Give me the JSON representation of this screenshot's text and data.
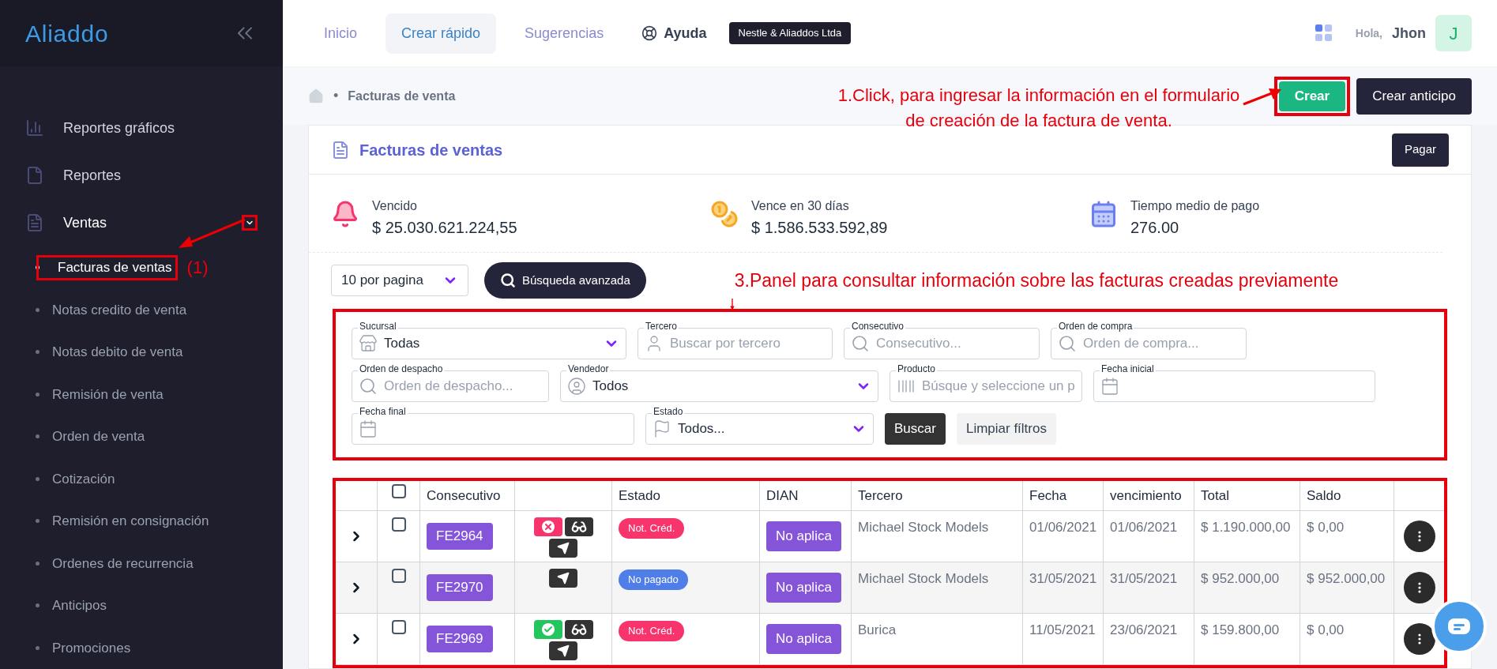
{
  "sidebar": {
    "logo": "Aliaddo",
    "items": [
      {
        "label": "Reportes gráficos",
        "expanded": false
      },
      {
        "label": "Reportes",
        "expanded": false
      },
      {
        "label": "Ventas",
        "expanded": true,
        "children": [
          {
            "label": "Facturas de ventas",
            "selected": true
          },
          {
            "label": "Notas credito de venta",
            "selected": false
          },
          {
            "label": "Notas debito de venta",
            "selected": false
          },
          {
            "label": "Remisión de venta",
            "selected": false
          },
          {
            "label": "Orden de venta",
            "selected": false
          },
          {
            "label": "Cotización",
            "selected": false
          },
          {
            "label": "Remisión en consignación",
            "selected": false
          },
          {
            "label": "Ordenes de recurrencia",
            "selected": false
          },
          {
            "label": "Anticipos",
            "selected": false
          },
          {
            "label": "Promociones",
            "selected": false
          }
        ]
      }
    ]
  },
  "topnav": {
    "tabs": [
      {
        "label": "Inicio",
        "selected": false
      },
      {
        "label": "Crear rápido",
        "selected": true
      },
      {
        "label": "Sugerencias",
        "selected": false
      }
    ],
    "help": "Ayuda",
    "company": "Nestle & Aliaddos Ltda",
    "greeting": "Hola,",
    "user": "Jhon",
    "avatar": "J"
  },
  "breadcrumb": {
    "current": "Facturas de venta",
    "separator": "•"
  },
  "actions": [
    "Crear",
    "Crear anticipo"
  ],
  "page": {
    "title": "Facturas de ventas",
    "action": "Pagar"
  },
  "stats": [
    {
      "label": "Vencido",
      "value": "$ 25.030.621.224,55"
    },
    {
      "label": "Vence en 30 días",
      "value": "$ 1.586.533.592,89"
    },
    {
      "label": "Tiempo medio de pago",
      "value": "276.00"
    }
  ],
  "per_page": "10 por pagina",
  "advanced_search": "Búsqueda avanzada",
  "filters": [
    {
      "kind": "select",
      "label": "Sucursal",
      "value": "Todas"
    },
    {
      "kind": "person",
      "label": "Tercero",
      "placeholder": "Buscar por tercero"
    },
    {
      "kind": "search",
      "label": "Consecutivo",
      "placeholder": "Consecutivo..."
    },
    {
      "kind": "search",
      "label": "Orden de compra",
      "placeholder": "Orden de compra..."
    },
    {
      "kind": "search",
      "label": "Orden de despacho",
      "placeholder": "Orden de despacho..."
    },
    {
      "kind": "seller",
      "label": "Vendedor",
      "value": "Todos"
    },
    {
      "kind": "barcode",
      "label": "Producto",
      "placeholder": "Búsque y seleccione un p"
    },
    {
      "kind": "date",
      "label": "Fecha inicial"
    },
    {
      "kind": "date",
      "label": "Fecha final"
    },
    {
      "kind": "status",
      "label": "Estado",
      "value": "Todos..."
    }
  ],
  "filter_buttons": [
    "Buscar",
    "Limpiar fíltros"
  ],
  "table": {
    "columns": [
      "Consecutivo",
      "Estado",
      "DIAN",
      "Tercero",
      "Fecha",
      "vencimiento",
      "Total",
      "Saldo"
    ],
    "all_checked": false,
    "rows": [
      {
        "checked": false,
        "number": "FE2964",
        "icons": [
          {
            "kind": "annulled"
          },
          {
            "kind": "view"
          },
          {
            "kind": "send"
          }
        ],
        "status": {
          "label": "Not. Créd.",
          "color": "#f7346b"
        },
        "dian": "No aplica",
        "party": "Michael Stock Models",
        "date": "01/06/2021",
        "due": "01/06/2021",
        "total": "$ 1.190.000,00",
        "balance": "$ 0,00"
      },
      {
        "checked": false,
        "number": "FE2970",
        "icons": [
          {
            "kind": "send"
          }
        ],
        "status": {
          "label": "No pagado",
          "color": "#4f7ee8"
        },
        "dian": "No aplica",
        "party": "Michael Stock Models",
        "date": "31/05/2021",
        "due": "31/05/2021",
        "total": "$ 952.000,00",
        "balance": "$ 952.000,00"
      },
      {
        "checked": false,
        "number": "FE2969",
        "icons": [
          {
            "kind": "approved"
          },
          {
            "kind": "view"
          },
          {
            "kind": "send"
          }
        ],
        "status": {
          "label": "Not. Créd.",
          "color": "#f7346b"
        },
        "dian": "No aplica",
        "party": "Burica",
        "date": "11/05/2021",
        "due": "23/06/2021",
        "total": "$ 159.800,00",
        "balance": "$ 0,00"
      }
    ]
  },
  "annotations": {
    "sidebar": "(1)",
    "create": "1.Click, para ingresar la información en el formulario de creación de la factura de venta.",
    "panel": "3.Panel para consultar información sobre las facturas creadas previamente"
  }
}
